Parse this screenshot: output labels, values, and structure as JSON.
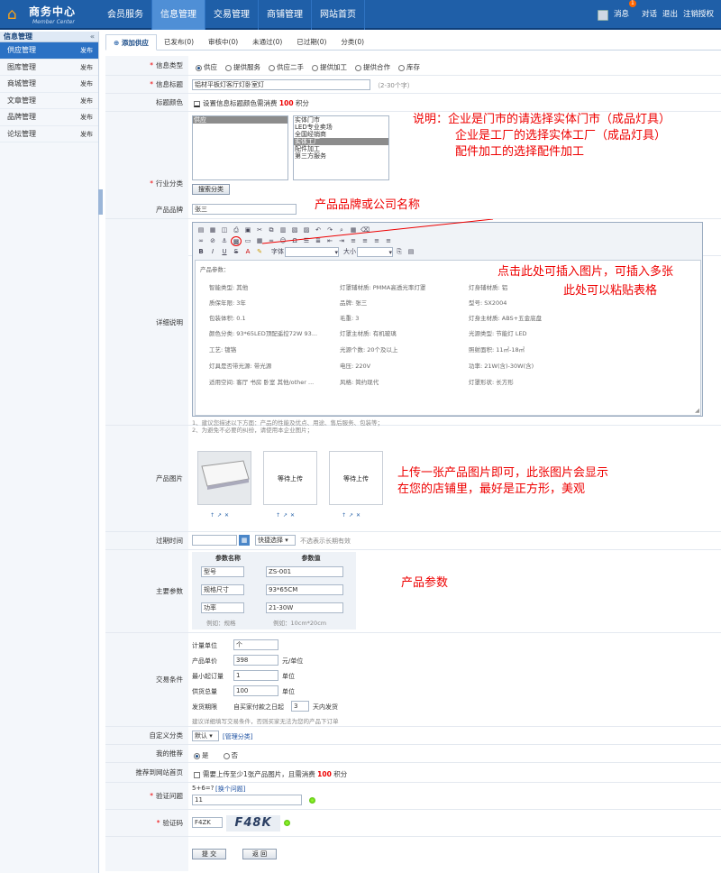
{
  "header": {
    "logo_title": "商务中心",
    "logo_subtitle": "Member Center",
    "nav": [
      "会员服务",
      "信息管理",
      "交易管理",
      "商铺管理",
      "网站首页"
    ],
    "msg_label": "消息",
    "msg_count": "1",
    "talk_label": "对话",
    "logout_label": "退出",
    "logout_auth_label": "注销授权"
  },
  "sidebar": {
    "title": "信息管理",
    "items": [
      {
        "label": "供应管理",
        "action": "发布"
      },
      {
        "label": "图库管理",
        "action": "发布"
      },
      {
        "label": "商城管理",
        "action": "发布"
      },
      {
        "label": "文章管理",
        "action": "发布"
      },
      {
        "label": "品牌管理",
        "action": "发布"
      },
      {
        "label": "论坛管理",
        "action": "发布"
      }
    ]
  },
  "tabs": [
    "添加供应",
    "已发布(0)",
    "审核中(0)",
    "未通过(0)",
    "已过期(0)",
    "分类(0)"
  ],
  "form": {
    "type_label": "信息类型",
    "types": [
      "供应",
      "提供服务",
      "供应二手",
      "提供加工",
      "提供合作",
      "库存"
    ],
    "title_label": "信息标题",
    "title_value": "铝材平板灯客厅灯卧室灯",
    "title_hint": "（2-30个字）",
    "color_label": "标题颜色",
    "color_text_pre": "设置信息标题颜色需消费",
    "color_cost": "100",
    "color_text_post": "积分",
    "industry_label": "行业分类",
    "industry_left": [
      "供应"
    ],
    "industry_right": [
      "实体门市",
      "LED专业卖场",
      "全国经销商",
      "实体工厂",
      "配件加工",
      "第三方服务"
    ],
    "industry_search": "搜索分类",
    "brand_label": "产品品牌",
    "brand_value": "张三",
    "detail_label": "详细说明",
    "font_label": "字体",
    "size_label": "大小",
    "detail_heading": "产品参数：",
    "detail_cells": [
      "智能类型: 其他",
      "灯罩辅材质: PMMA高透光率灯罩",
      "灯身辅材质: 铝",
      "质保年限: 3年",
      "品牌: 张三",
      "型号: SX2004",
      "包装体积: 0.1",
      "毛重: 3",
      "灯身主材质: ABS+五金底盘",
      "颜色分类: 93*65LED顶配遥控72W 93...",
      "灯罩主材质: 有机玻璃",
      "光源类型: 节能灯 LED",
      "工艺: 镀铬",
      "光源个数: 20个及以上",
      "照射面积: 11㎡-18㎡",
      "灯具是否带光源: 带光源",
      "电压: 220V",
      "功率: 21W(含)-30W(含)",
      "适用空间: 客厅 书房 卧室 其他/other ...",
      "风格: 简约现代",
      "灯罩形状: 长方形"
    ],
    "detail_tip1": "1、建议您描述以下方面：产品的性能及优点、用途、售后服务、包装等；",
    "detail_tip2": "2、为避免不必要的纠纷，请使用本企业图片；",
    "image_label": "产品图片",
    "image_wait": "等待上传",
    "image_arrows": "↑↗✕",
    "expire_label": "过期时间",
    "expire_select": "快捷选择",
    "expire_hint": "不选表示长期有效",
    "params_label": "主要参数",
    "params_head_name": "参数名称",
    "params_head_value": "参数值",
    "params": [
      {
        "name": "型号",
        "value": "ZS-001"
      },
      {
        "name": "规格尺寸",
        "value": "93*65CM"
      },
      {
        "name": "功率",
        "value": "21-30W"
      }
    ],
    "params_example_name": "例如：规格",
    "params_example_value": "例如：10cm*20cm",
    "trade_label": "交易条件",
    "unit_label": "计量单位",
    "unit_value": "个",
    "price_label": "产品单价",
    "price_value": "398",
    "price_suffix": "元/单位",
    "min_label": "最小起订量",
    "min_value": "1",
    "min_suffix": "单位",
    "total_label": "供货总量",
    "total_value": "100",
    "total_suffix": "单位",
    "ship_label": "发货期限",
    "ship_pre": "自买家付款之日起",
    "ship_value": "3",
    "ship_suffix": "天内发货",
    "trade_hint": "建议详细填写交易条件，否则买家无法为您的产品下订单",
    "custom_label": "自定义分类",
    "custom_value": "默认",
    "custom_link": "[管理分类]",
    "recommend_label": "我的推荐",
    "recommend_yes": "是",
    "recommend_no": "否",
    "home_label": "推荐到网站首页",
    "home_pre": "需要上传至少1张产品图片，且需消费",
    "home_cost": "100",
    "home_post": "积分",
    "q_label": "验证问题",
    "q_text": "5+6=?",
    "q_change": "[换个问题]",
    "q_value": "11",
    "code_label": "验证码",
    "code_value": "F4ZK",
    "captcha_text": "F48K",
    "submit": "提 交",
    "back": "返 回"
  },
  "notes": {
    "n1a": "说明：企业是门市的请选择实体门市（成品灯具）",
    "n1b": "企业是工厂的选择实体工厂（成品灯具）",
    "n1c": "配件加工的选择配件加工",
    "n2": "产品品牌或公司名称",
    "n3": "点击此处可插入图片，可插入多张",
    "n4": "此处可以粘贴表格",
    "n5a": "上传一张产品图片即可，此张图片会显示",
    "n5b": "在您的店铺里，最好是正方形，美观",
    "n6": "产品参数"
  },
  "colors": {
    "accent": "#1f5fa8",
    "annotation": "#e00000"
  }
}
